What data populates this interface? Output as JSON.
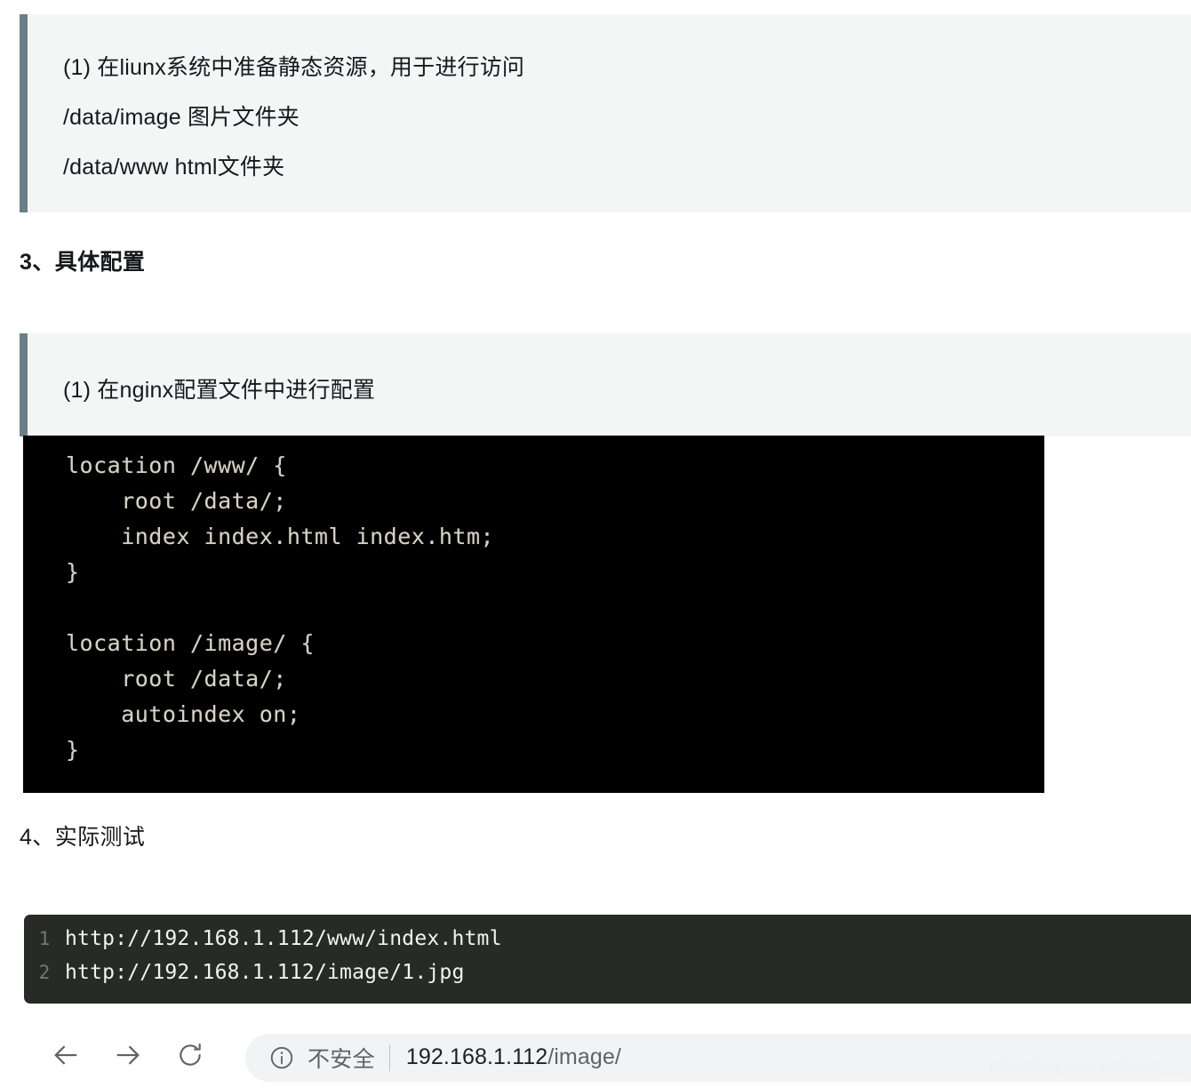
{
  "blockquote_1": {
    "lines": [
      "(1) 在liunx系统中准备静态资源，用于进行访问",
      "/data/image 图片文件夹",
      "/data/www html文件夹"
    ]
  },
  "heading_3": "3、具体配置",
  "blockquote_2": {
    "lines": [
      "(1) 在nginx配置文件中进行配置"
    ]
  },
  "code_block_nginx": {
    "lines": [
      "location /www/ {",
      "    root /data/;",
      "    index index.html index.htm;",
      "}",
      "",
      "location /image/ {",
      "    root /data/;",
      "    autoindex on;",
      "}"
    ]
  },
  "heading_4": "4、实际测试",
  "code_block_urls": {
    "rows": [
      {
        "number": "1",
        "text": "http://192.168.1.112/www/index.html"
      },
      {
        "number": "2",
        "text": "http://192.168.1.112/image/1.jpg"
      }
    ]
  },
  "browser_toolbar": {
    "back_icon": "arrow-left-icon",
    "forward_icon": "arrow-right-icon",
    "reload_icon": "reload-icon",
    "security_icon": "info-circle-icon",
    "security_label": "不安全",
    "url_host": "192.168.1.112",
    "url_path": "/image/"
  },
  "watermark": "https://blog.csdn.net/Insist___",
  "colors": {
    "blockquote_bg": "#f4f5f5",
    "blockquote_border": "#6b7f88",
    "terminal_bg": "#000000",
    "terminal_text": "#d6d2c6",
    "code_bg": "#282a26",
    "code_text": "#f2f2f2",
    "gutter_text": "#737a73",
    "omnibox_bg": "#f1f3f4",
    "toolbar_icon": "#5f6368"
  }
}
